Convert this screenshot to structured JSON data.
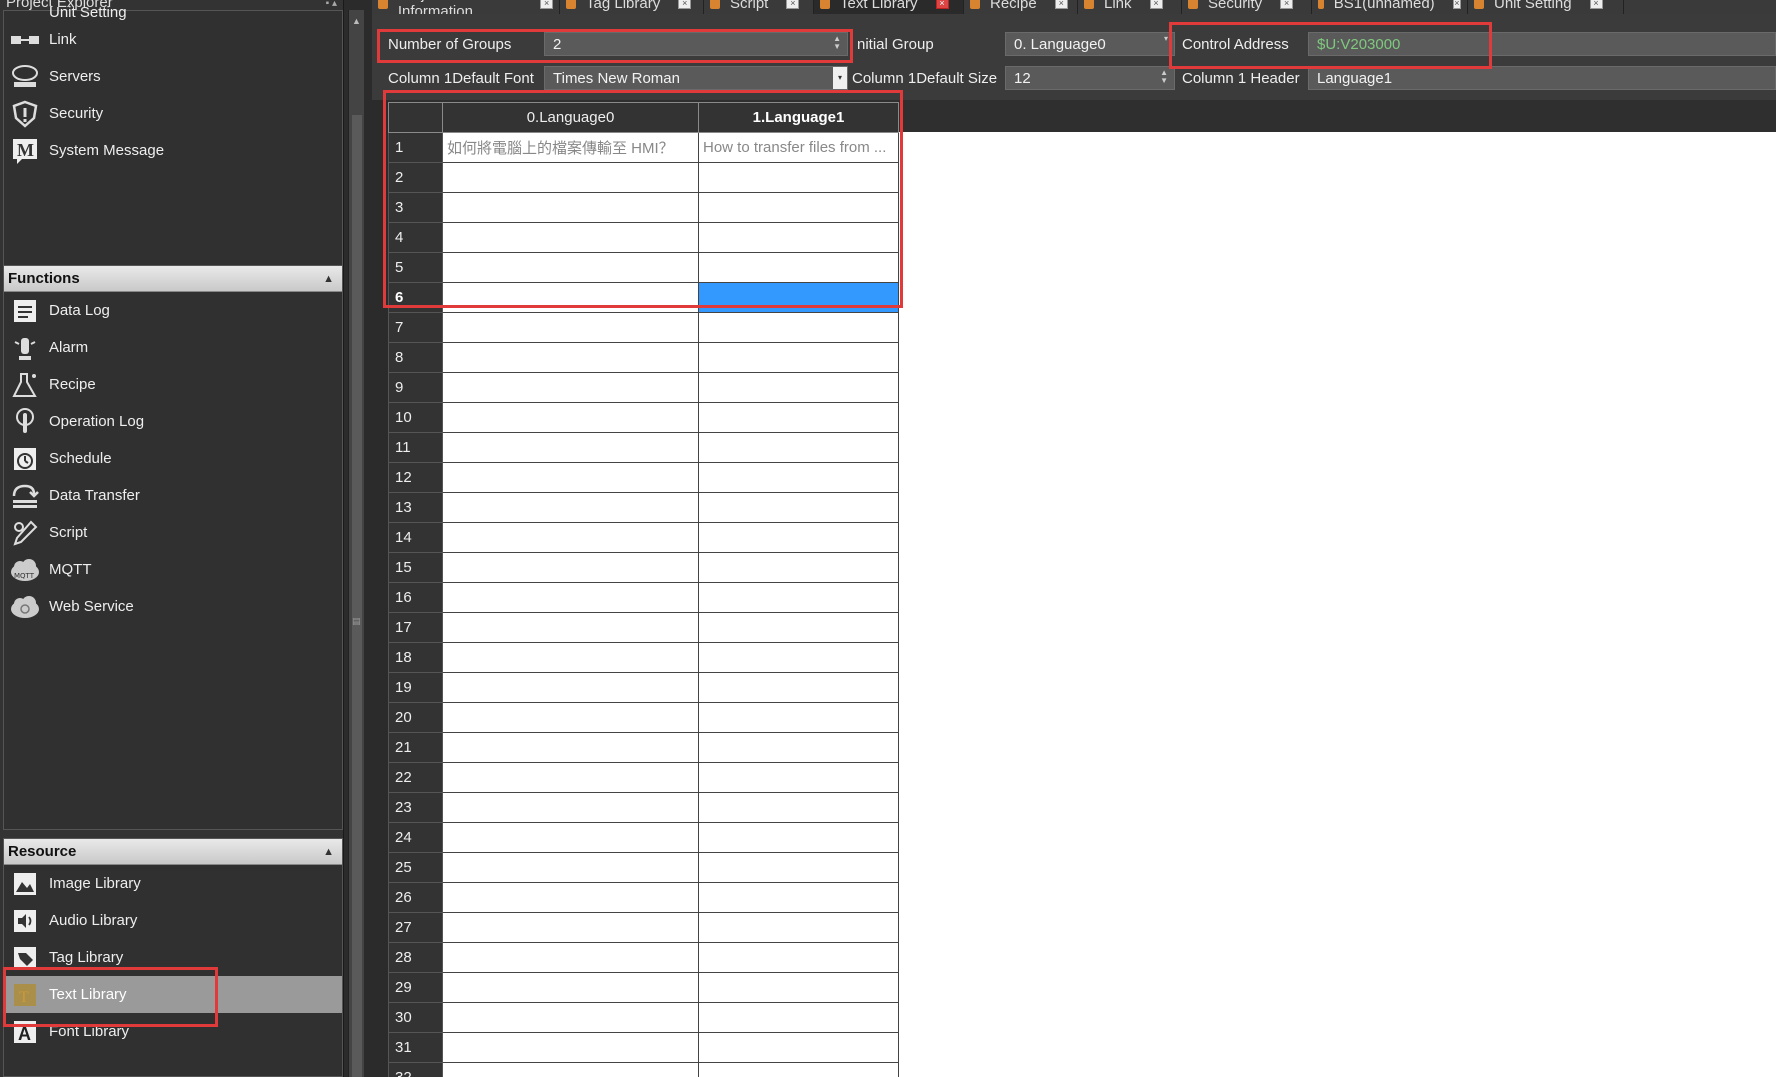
{
  "explorer": {
    "title": "Project Explorer",
    "top_items": [
      {
        "label": "Unit Setting",
        "icon": "unit-setting-icon"
      },
      {
        "label": "Link",
        "icon": "link-icon"
      },
      {
        "label": "Servers",
        "icon": "servers-icon"
      },
      {
        "label": "Security",
        "icon": "shield-icon"
      },
      {
        "label": "System Message",
        "icon": "system-message-icon"
      }
    ],
    "functions": {
      "header": "Functions",
      "items": [
        {
          "label": "Data Log",
          "icon": "data-log-icon"
        },
        {
          "label": "Alarm",
          "icon": "alarm-icon"
        },
        {
          "label": "Recipe",
          "icon": "recipe-flask-icon"
        },
        {
          "label": "Operation Log",
          "icon": "operation-log-icon"
        },
        {
          "label": "Schedule",
          "icon": "schedule-clock-icon"
        },
        {
          "label": "Data Transfer",
          "icon": "data-transfer-icon"
        },
        {
          "label": "Script",
          "icon": "script-icon"
        },
        {
          "label": "MQTT",
          "icon": "mqtt-cloud-icon"
        },
        {
          "label": "Web Service",
          "icon": "web-service-cloud-icon"
        }
      ]
    },
    "resource": {
      "header": "Resource",
      "items": [
        {
          "label": "Image Library",
          "icon": "image-library-icon"
        },
        {
          "label": "Audio Library",
          "icon": "audio-library-icon"
        },
        {
          "label": "Tag Library",
          "icon": "tag-library-icon"
        },
        {
          "label": "Text Library",
          "icon": "text-library-icon",
          "selected": true
        },
        {
          "label": "Font Library",
          "icon": "font-library-icon"
        }
      ]
    }
  },
  "tabs": [
    {
      "label": "Project Information"
    },
    {
      "label": "Tag Library"
    },
    {
      "label": "Script"
    },
    {
      "label": "Text Library",
      "active": true
    },
    {
      "label": "Recipe"
    },
    {
      "label": "Link"
    },
    {
      "label": "Security"
    },
    {
      "label": "BS1(unnamed)"
    },
    {
      "label": "Unit Setting"
    }
  ],
  "props": {
    "num_groups_label": "Number of Groups",
    "num_groups_value": "2",
    "initial_group_label": "nitial Group",
    "initial_group_value": "0.  Language0",
    "control_address_label": "Control Address",
    "control_address_value": "$U:V203000",
    "col_font_label": "Column 1Default Font",
    "col_font_value": "Times New Roman",
    "col_size_label": "Column 1Default Size",
    "col_size_value": "12",
    "col_header_label": "Column 1 Header",
    "col_header_value": "Language1"
  },
  "grid": {
    "columns": [
      "0.Language0",
      "1.Language1"
    ],
    "row1": [
      "如何將電腦上的檔案傳輸至 HMI？",
      "How to transfer files from ..."
    ],
    "row_count": 32,
    "selected_row": 6
  },
  "colors": {
    "highlight": "#e03a3a",
    "selection": "#3399ff",
    "address_text": "#7fc97f"
  }
}
